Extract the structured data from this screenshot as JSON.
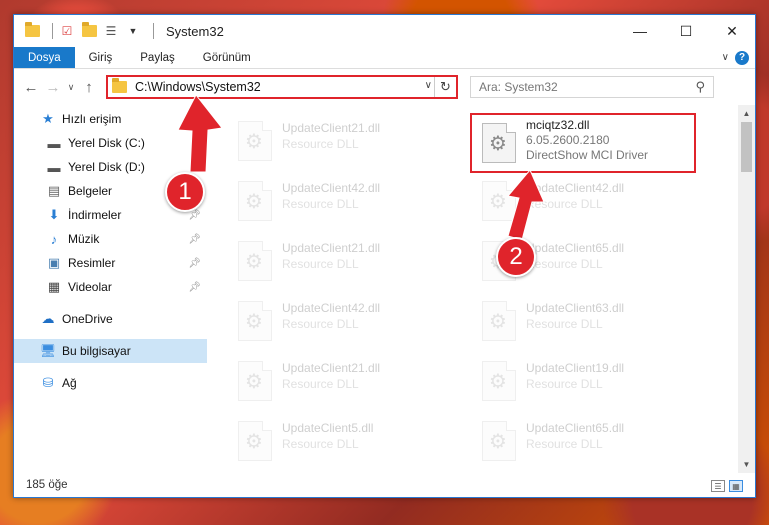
{
  "window": {
    "title": "System32",
    "controls": {
      "minimize": "—",
      "maximize": "☐",
      "close": "✕"
    }
  },
  "ribbon": {
    "tabs": [
      {
        "label": "Dosya"
      },
      {
        "label": "Giriş"
      },
      {
        "label": "Paylaş"
      },
      {
        "label": "Görünüm"
      }
    ],
    "chevron": "∨",
    "help": "?"
  },
  "address": {
    "path": "C:\\Windows\\System32",
    "search_placeholder": "Ara: System32",
    "dropdown": "∨",
    "refresh": "↻"
  },
  "nav": {
    "quick_access": "Hızlı erişim",
    "items": [
      {
        "label": "Yerel Disk (C:)",
        "icon": "drive-icon",
        "pinned": false
      },
      {
        "label": "Yerel Disk (D:)",
        "icon": "drive-icon",
        "pinned": false
      },
      {
        "label": "Belgeler",
        "icon": "documents-icon",
        "pinned": false
      },
      {
        "label": "İndirmeler",
        "icon": "download-icon",
        "pinned": true
      },
      {
        "label": "Müzik",
        "icon": "music-icon",
        "pinned": true
      },
      {
        "label": "Resimler",
        "icon": "pictures-icon",
        "pinned": true
      },
      {
        "label": "Videolar",
        "icon": "video-icon",
        "pinned": true
      }
    ],
    "onedrive": "OneDrive",
    "this_pc": "Bu bilgisayar",
    "network": "Ağ"
  },
  "files": {
    "highlighted": {
      "name": "mciqtz32.dll",
      "version": "6.05.2600.2180",
      "desc": "DirectShow MCI Driver"
    },
    "left_column": [
      {
        "name": "UpdateClient21.dll",
        "desc": "Resource DLL"
      },
      {
        "name": "UpdateClient42.dll",
        "desc": "Resource DLL"
      },
      {
        "name": "UpdateClient21.dll",
        "desc": "Resource DLL"
      },
      {
        "name": "UpdateClient42.dll",
        "desc": "Resource DLL"
      },
      {
        "name": "UpdateClient21.dll",
        "desc": "Resource DLL"
      },
      {
        "name": "UpdateClient5.dll",
        "desc": "Resource DLL"
      }
    ],
    "right_column": [
      {
        "name": "UpdateClient42.dll",
        "desc": "Resource DLL"
      },
      {
        "name": "UpdateClient65.dll",
        "desc": "Resource DLL"
      },
      {
        "name": "UpdateClient63.dll",
        "desc": "Resource DLL"
      },
      {
        "name": "UpdateClient19.dll",
        "desc": "Resource DLL"
      },
      {
        "name": "UpdateClient65.dll",
        "desc": "Resource DLL"
      }
    ]
  },
  "status": {
    "count": "185 öğe"
  },
  "annotations": {
    "badge1": "1",
    "badge2": "2",
    "color": "#e0242b"
  }
}
